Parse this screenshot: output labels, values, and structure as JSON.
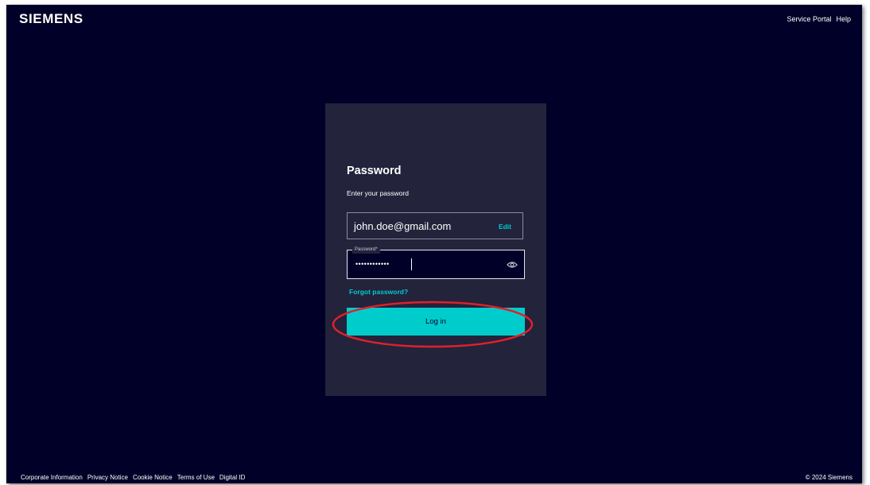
{
  "header": {
    "logo": "SIEMENS",
    "links": [
      "Service Portal",
      "Help"
    ]
  },
  "card": {
    "title": "Password",
    "subtitle": "Enter your password",
    "email": {
      "value": "john.doe@gmail.com",
      "edit_label": "Edit"
    },
    "password": {
      "label": "Password*",
      "masked_value": "••••••••••••",
      "toggle_icon": "eye-icon"
    },
    "forgot_label": "Forgot password?",
    "login_label": "Log in"
  },
  "footer": {
    "links": [
      "Corporate Information",
      "Privacy Notice",
      "Cookie Notice",
      "Terms of Use",
      "Digital ID"
    ],
    "copyright": "© 2024 Siemens"
  },
  "colors": {
    "background": "#000028",
    "card": "#23233c",
    "accent": "#00cccc",
    "highlight": "#e0202a"
  },
  "annotation": {
    "type": "highlight-oval",
    "target": "login-button"
  }
}
